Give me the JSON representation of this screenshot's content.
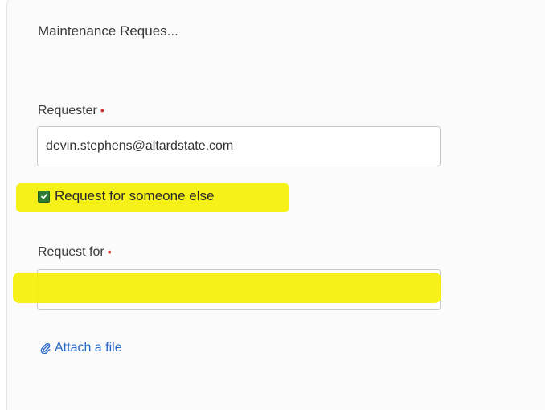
{
  "form": {
    "title": "Maintenance Reques...",
    "requester": {
      "label": "Requester",
      "required_marker": "•",
      "value": "devin.stephens@altardstate.com"
    },
    "request_for_someone_else": {
      "label": "Request for someone else",
      "checked": true
    },
    "request_for": {
      "label": "Request for",
      "required_marker": "•",
      "value": ""
    },
    "attach": {
      "label": "Attach a file",
      "icon": "paperclip-icon"
    }
  },
  "colors": {
    "highlight": "#f4f000",
    "checkbox": "#2e7d32",
    "link": "#2767c8",
    "required": "#d32f2f"
  }
}
